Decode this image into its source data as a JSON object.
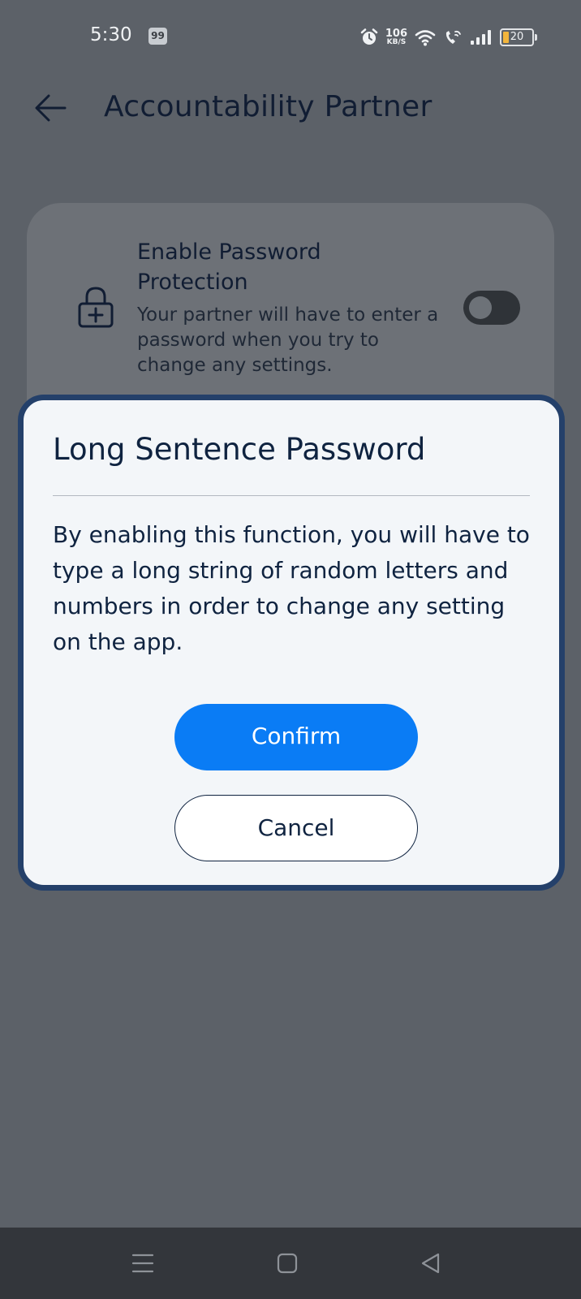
{
  "status_bar": {
    "time": "5:30",
    "notification_badge": "99",
    "network_speed": "106",
    "network_speed_unit": "KB/S",
    "battery_level": "20",
    "battery_color": "#f2b53c"
  },
  "header": {
    "title": "Accountability Partner",
    "back_icon": "arrow-left-icon"
  },
  "setting": {
    "icon": "lock-plus-icon",
    "title": "Enable Password Protection",
    "description": "Your partner will have to enter a password when you try to change any settings.",
    "toggle_on": false
  },
  "dialog": {
    "title": "Long Sentence Password",
    "body": "By enabling this function, you will have to type a long string of random letters and numbers in order to change any setting on the app.",
    "confirm_label": "Confirm",
    "cancel_label": "Cancel",
    "accent_color": "#0a7cf5",
    "border_color": "#24406a"
  },
  "nav_bar": {
    "items": [
      "menu-icon",
      "home-icon",
      "back-triangle-icon"
    ]
  }
}
